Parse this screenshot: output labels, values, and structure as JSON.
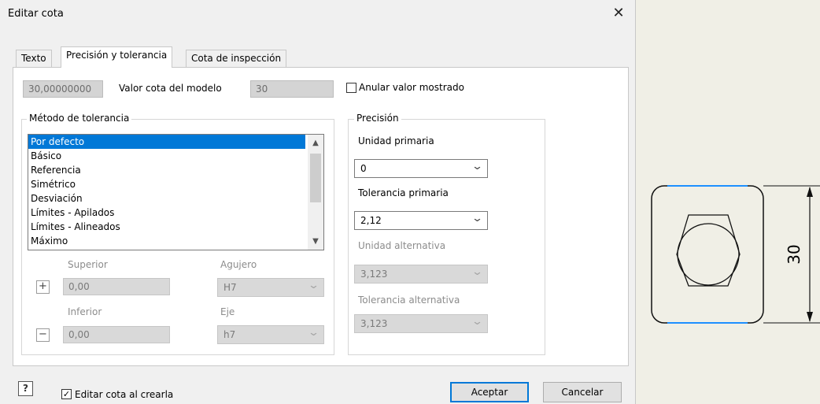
{
  "window": {
    "title": "Editar cota",
    "close_glyph": "✕"
  },
  "tabs": [
    {
      "label": "Texto",
      "active": false
    },
    {
      "label": "Precisión y tolerancia",
      "active": true
    },
    {
      "label": "Cota de inspección",
      "active": false
    }
  ],
  "model_value": {
    "exact_value": "30,00000000",
    "label": "Valor cota del modelo",
    "rounded_value": "30",
    "override_label": "Anular valor mostrado",
    "override_checked": false
  },
  "tolerance_method": {
    "legend": "Método de tolerancia",
    "items": [
      "Por defecto",
      "Básico",
      "Referencia",
      "Simétrico",
      "Desviación",
      "Límites - Apilados",
      "Límites - Alineados",
      "Máximo"
    ],
    "selected_index": 0,
    "upper_label": "Superior",
    "upper_value": "0,00",
    "lower_label": "Inferior",
    "lower_value": "0,00",
    "hole_label": "Agujero",
    "hole_value": "H7",
    "shaft_label": "Eje",
    "shaft_value": "h7"
  },
  "precision": {
    "legend": "Precisión",
    "primary_unit_label": "Unidad primaria",
    "primary_unit_value": "0",
    "primary_tolerance_label": "Tolerancia primaria",
    "primary_tolerance_value": "2,12",
    "alt_unit_label": "Unidad alternativa",
    "alt_unit_value": "3,123",
    "alt_tolerance_label": "Tolerancia alternativa",
    "alt_tolerance_value": "3,123"
  },
  "footer": {
    "edit_on_create_label": "Editar cota al crearla",
    "edit_on_create_checked": true,
    "ok_label": "Aceptar",
    "cancel_label": "Cancelar"
  },
  "drawing": {
    "dimension_text": "30"
  },
  "colors": {
    "accent": "#0078d7",
    "selection": "#0078d7",
    "drawing_highlight": "#1e90ff"
  },
  "icons": {
    "help": "help-icon",
    "close": "close-icon",
    "plus": "plus-icon",
    "minus": "minus-icon",
    "chevron": "chevron-down-icon"
  }
}
